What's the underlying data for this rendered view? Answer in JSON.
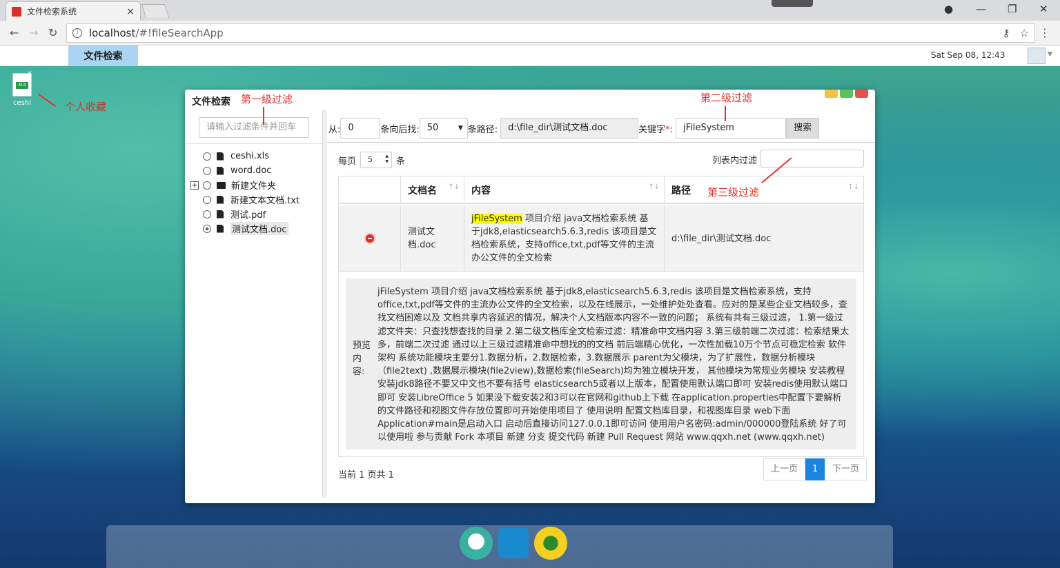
{
  "browser": {
    "tab_title": "文件检索系统",
    "tab_close": "×",
    "url_host": "localhost",
    "url_path": "/#!fileSearchApp",
    "win_min": "—",
    "win_restore": "❐",
    "win_close": "✕",
    "nav_back": "←",
    "nav_forward": "→",
    "nav_reload": "↻",
    "key_icon": "⚷",
    "star_icon": "☆",
    "menu_icon": "⋮",
    "account_icon": "●"
  },
  "appbar": {
    "tab_label": "文件检索",
    "datetime": "Sat Sep 08, 12:43",
    "avatar_caret": "▼"
  },
  "desktop": {
    "icon_label": "ceshi",
    "icon_badge": "XLS",
    "icon_close": "×"
  },
  "annotations": {
    "personal": "个人收藏",
    "level1": "第一级过滤",
    "level2": "第二级过滤",
    "level3": "第三级过滤"
  },
  "window": {
    "title": "文件检索",
    "btn_colors": [
      "#f5c142",
      "#5cc05c",
      "#e0524a"
    ]
  },
  "left": {
    "filter_placeholder": "请输入过滤条件并回车",
    "tree": [
      {
        "label": "ceshi.xls",
        "type": "file"
      },
      {
        "label": "word.doc",
        "type": "file"
      },
      {
        "label": "新建文件夹",
        "type": "folder",
        "expander": "+"
      },
      {
        "label": "新建文本文档.txt",
        "type": "file"
      },
      {
        "label": "测试.pdf",
        "type": "file"
      },
      {
        "label": "测试文档.doc",
        "type": "file",
        "selected": true
      }
    ]
  },
  "form": {
    "from_label": "从:",
    "from_value": "0",
    "after_label": "条向后找:",
    "count_value": "50",
    "count_caret": "▼",
    "path_label": "条路径:",
    "path_value": "d:\\file_dir\\测试文档.doc",
    "keyword_label": "关键字",
    "required_mark": "*",
    "colon": ":",
    "keyword_value": "jFileSystem",
    "search_btn": "搜索"
  },
  "list": {
    "per_page_prefix": "每页",
    "per_page_value": "5",
    "per_page_suffix": "条",
    "list_filter_label": "列表内过滤",
    "columns": [
      "",
      "文档名",
      "内容",
      "路径"
    ],
    "sort_icon": "↑↓",
    "row": {
      "name": "测试文档.doc",
      "content_highlight": "jFileSystem",
      "content_rest": " 项目介绍 java文档检索系统 基于jdk8,elasticsearch5.6.3,redis 该项目是文档检索系统，支持office,txt,pdf等文件的主流办公文件的全文检索",
      "path": "d:\\file_dir\\测试文档.doc"
    },
    "preview_label": "预览内容:",
    "preview_text": "jFileSystem 项目介绍 java文档检索系统 基于jdk8,elasticsearch5.6.3,redis 该项目是文档检索系统，支持office,txt,pdf等文件的主流办公文件的全文检索，以及在线展示，一处维护处处查看。应对的是某些企业文档较多，查找文档困难以及 文档共享内容延迟的情况，解决个人文档版本内容不一致的问题； 系统有共有三级过滤， 1.第一级过滤文件夹：只查找想查找的目录 2.第二级文档库全文检索过滤：精准命中文档内容 3.第三级前端二次过滤：检索结果太多，前端二次过滤 通过以上三级过滤精准命中想找的的文档 前后端精心优化，一次性加载10万个节点可稳定检索 软件架构 系统功能模块主要分1.数据分析，2.数据检索，3.数据展示 parent为父模块，为了扩展性，数据分析模块（file2text) ,数据展示模块(file2view),数据检索(fileSearch)均为独立模块开发， 其他模块为常规业务模块 安装教程 安装jdk8路径不要又中文也不要有括号 elasticsearch5或者以上版本，配置使用默认端口即可 安装redis使用默认端口即可 安装LibreOffice 5 如果没下载安装2和3可以在官网和github上下载 在application.properties中配置下要解析的文件路径和视图文件存放位置即可开始使用项目了 使用说明 配置文档库目录，和视图库目录 web下面Application#main是启动入口 启动后直接访问127.0.0.1即可访问 使用用户名密码:admin/000000登陆系统 好了可以使用啦 参与贡献 Fork 本项目 新建 分支 提交代码 新建 Pull Request 网站 www.qqxh.net (www.qqxh.net)",
    "pager_info": "当前 1 页共 1",
    "prev": "上一页",
    "page": "1",
    "next": "下一页"
  },
  "dock": {
    "items": [
      "search-cloud-icon",
      "presentation-icon",
      "add-icon"
    ],
    "colors": [
      "#3ab0a0",
      "#1a8ad0",
      "#f5d020"
    ]
  }
}
